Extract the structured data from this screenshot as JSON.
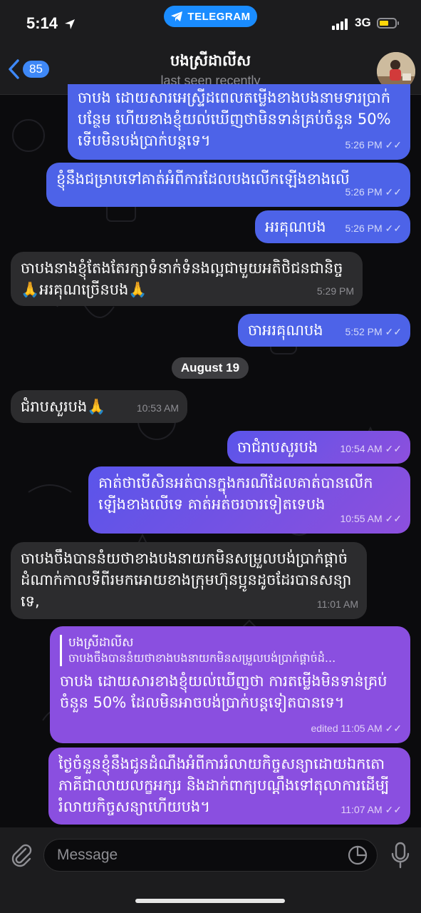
{
  "status_bar": {
    "time": "5:14",
    "telegram_label": "TELEGRAM",
    "network": "3G"
  },
  "header": {
    "unread_count": "85",
    "contact_name": "បងស្រីដាលីស",
    "last_seen": "last seen recently"
  },
  "messages": [
    {
      "dir": "out",
      "text": "ចាបង ដោយសារអេស្ទ្រីដពេលតម្លើងខាងបងនាមទារប្រាក់បន្ថែម ហើយខាងខ្ញុំយល់ឃើញថាមិនទាន់គ្រប់ចំនួន 50% ទើបមិនបង់ប្រាក់បន្តទេ។",
      "time": "5:26 PM"
    },
    {
      "dir": "out",
      "text": "ខ្ញុំនឹងជម្រាបទៅគាត់អំពីការដែលបងលើកឡើងខាងលើ",
      "time": "5:26 PM"
    },
    {
      "dir": "out",
      "text": "អរគុណបង",
      "time": "5:26 PM"
    },
    {
      "dir": "in",
      "text": "ចាបងនាងខ្ញុំតែងតែរក្សាទំនាក់ទំនងល្អជាមួយអតិថិជនជានិច្ច🙏អរគុណច្រើនបង🙏",
      "time": "5:29 PM"
    },
    {
      "dir": "out",
      "text": "ចាអរគុណបង",
      "time": "5:52 PM"
    },
    {
      "dir": "in",
      "text": "ជំរាបសួរបង🙏",
      "time": "10:53 AM"
    },
    {
      "dir": "out",
      "text": "ចាជំរាបសួរបង",
      "time": "10:54 AM"
    },
    {
      "dir": "out",
      "text": "គាត់ថាបើសិនអត់បានក្នុងករណីដែលគាត់បានលើកឡើងខាងលើទេ គាត់អត់ចរចារទៀតទេបង",
      "time": "10:55 AM"
    },
    {
      "dir": "in",
      "text": "ចាបងចឹងបាននំយថាខាងបងនាយកមិនសម្រួលបង់ប្រាក់ផ្តាច់ដំណាក់កាលទីពីរមកអោយខាងក្រុមហ៊ុនប្អូនដូចដែរបានសន្យាទេ,",
      "time": "11:01 AM"
    },
    {
      "dir": "out",
      "reply_name": "បងស្រីដាលីស",
      "reply_text": "ចាបងចឹងបាននំយថាខាងបងនាយកមិនសម្រួលបង់ប្រាក់ផ្តាច់ដំ...",
      "text": "ចាបង ដោយសារខាងខ្ញុំយល់ឃើញថា ការតម្លើងមិនទាន់គ្រប់ចំនួន 50% ដែលមិនអាចបង់ប្រាក់បន្តទៀតបានទេ។",
      "time": "edited 11:05 AM"
    },
    {
      "dir": "out",
      "text": "ថ្ងៃចំនួនខ្ញុំនឹងជូនដំណឹងអំពីការរំលាយកិច្ចសន្យាដោយឯកតោភាគីជាលាយលក្ខអក្សរ និងដាក់ពាក្យបណ្តឹងទៅតុលាការដើម្បីរំលាយកិច្ចសន្យាហើយបង។",
      "time": "11:07 AM"
    }
  ],
  "date_separator": "August 19",
  "composer": {
    "placeholder": "Message"
  },
  "colors": {
    "incoming": "#2c2c2e",
    "outgoing_blue": "#4d63e8",
    "outgoing_purple": "#8a4fe0",
    "accent": "#3e88f7"
  }
}
